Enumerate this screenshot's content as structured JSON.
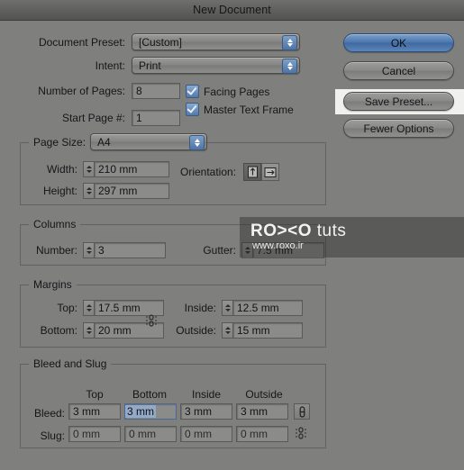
{
  "window": {
    "title": "New Document"
  },
  "top_fields": {
    "document_preset_label": "Document Preset:",
    "document_preset_value": "[Custom]",
    "intent_label": "Intent:",
    "intent_value": "Print",
    "number_of_pages_label": "Number of Pages:",
    "number_of_pages_value": "8",
    "start_page_label": "Start Page #:",
    "start_page_value": "1",
    "facing_pages_label": "Facing Pages",
    "master_text_frame_label": "Master Text Frame"
  },
  "buttons": {
    "ok": "OK",
    "cancel": "Cancel",
    "save_preset": "Save Preset...",
    "fewer_options": "Fewer Options"
  },
  "page_size": {
    "legend": "Page Size:",
    "preset_value": "A4",
    "width_label": "Width:",
    "width_value": "210 mm",
    "height_label": "Height:",
    "height_value": "297 mm",
    "orientation_label": "Orientation:",
    "orientation_portrait": "portrait-icon",
    "orientation_landscape": "landscape-icon"
  },
  "columns": {
    "legend": "Columns",
    "number_label": "Number:",
    "number_value": "3",
    "gutter_label": "Gutter:",
    "gutter_value": "7.5 mm"
  },
  "margins": {
    "legend": "Margins",
    "top_label": "Top:",
    "top_value": "17.5 mm",
    "bottom_label": "Bottom:",
    "bottom_value": "20 mm",
    "inside_label": "Inside:",
    "inside_value": "12.5 mm",
    "outside_label": "Outside:",
    "outside_value": "15 mm"
  },
  "bleed_slug": {
    "legend": "Bleed and Slug",
    "headers": [
      "Top",
      "Bottom",
      "Inside",
      "Outside"
    ],
    "bleed_label": "Bleed:",
    "bleed_values": [
      "3 mm",
      "3 mm",
      "3 mm",
      "3 mm"
    ],
    "slug_label": "Slug:",
    "slug_values": [
      "0 mm",
      "0 mm",
      "0 mm",
      "0 mm"
    ]
  },
  "watermark": {
    "brand": "RO><O",
    "suffix": " tuts",
    "url": "www.roxo.ir"
  },
  "colors": {
    "dialog_bg": "#7f7f7d",
    "accent_blue": "#4e74a6",
    "selection_blue": "#93a9c6",
    "highlight_band": "#f0f0ee"
  }
}
